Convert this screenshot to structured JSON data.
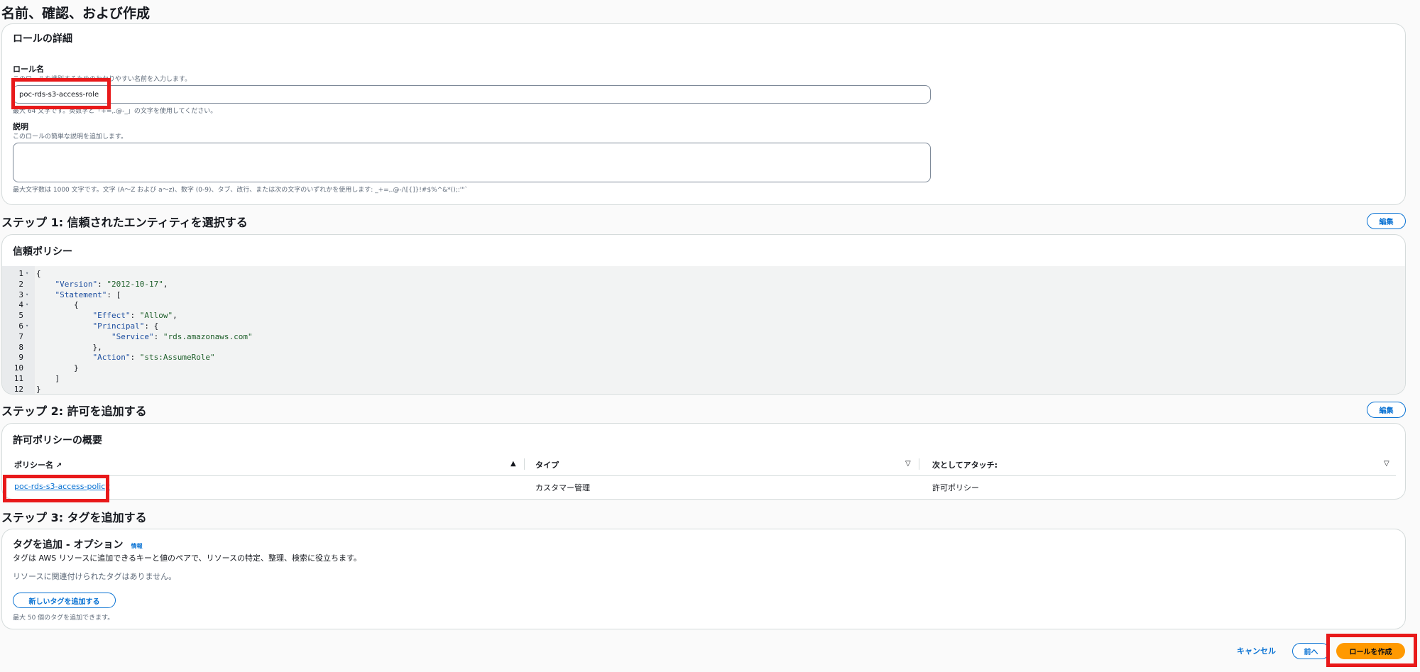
{
  "page_title": "名前、確認、および作成",
  "role_details": {
    "title": "ロールの詳細",
    "role_name_label": "ロール名",
    "role_name_hint": "このロールを識別するためのわかりやすい名前を入力します。",
    "role_name_value": "poc-rds-s3-access-role",
    "role_name_constraint": "最大 64 文字です。英数字と「+=,.@-_」の文字を使用してください。",
    "description_label": "説明",
    "description_hint": "このロールの簡単な説明を追加します。",
    "description_value": "",
    "description_constraint": "最大文字数は 1000 文字です。文字 (A〜Z および a〜z)、数字 (0-9)、タブ、改行、または次の文字のいずれかを使用します: _+=,.@-/\\[{]}!#$%^&*();:'\"`"
  },
  "step1": {
    "heading": "ステップ 1: 信頼されたエンティティを選択する",
    "edit_label": "編集",
    "trust_policy_title": "信頼ポリシー",
    "code_lines": [
      {
        "num": "1",
        "fold": true,
        "text": "{"
      },
      {
        "num": "2",
        "fold": false,
        "text": "    \"Version\": \"2012-10-17\","
      },
      {
        "num": "3",
        "fold": true,
        "text": "    \"Statement\": ["
      },
      {
        "num": "4",
        "fold": true,
        "text": "        {"
      },
      {
        "num": "5",
        "fold": false,
        "text": "            \"Effect\": \"Allow\","
      },
      {
        "num": "6",
        "fold": true,
        "text": "            \"Principal\": {"
      },
      {
        "num": "7",
        "fold": false,
        "text": "                \"Service\": \"rds.amazonaws.com\""
      },
      {
        "num": "8",
        "fold": false,
        "text": "            },"
      },
      {
        "num": "9",
        "fold": false,
        "text": "            \"Action\": \"sts:AssumeRole\""
      },
      {
        "num": "10",
        "fold": false,
        "text": "        }"
      },
      {
        "num": "11",
        "fold": false,
        "text": "    ]"
      },
      {
        "num": "12",
        "fold": false,
        "text": "}"
      }
    ]
  },
  "step2": {
    "heading": "ステップ 2: 許可を追加する",
    "edit_label": "編集",
    "summary_title": "許可ポリシーの概要",
    "columns": [
      "ポリシー名",
      "タイプ",
      "次としてアタッチ:"
    ],
    "rows": [
      {
        "policy_name": "poc-rds-s3-access-policy",
        "type": "カスタマー管理",
        "attached_as": "許可ポリシー"
      }
    ]
  },
  "step3": {
    "heading": "ステップ 3: タグを追加する",
    "tags_title": "タグを追加 - オプション",
    "info_label": "情報",
    "tags_desc": "タグは AWS リソースに追加できるキーと値のペアで、リソースの特定、整理、検索に役立ちます。",
    "no_tags": "リソースに関連付けられたタグはありません。",
    "add_tag_label": "新しいタグを追加する",
    "tag_limit": "最大 50 個のタグを追加できます。"
  },
  "footer": {
    "cancel_label": "キャンセル",
    "prev_label": "前へ",
    "create_label": "ロールを作成"
  },
  "colors": {
    "accent": "#0972d3",
    "primary_button": "#ff9900",
    "highlight": "#e8191a"
  }
}
